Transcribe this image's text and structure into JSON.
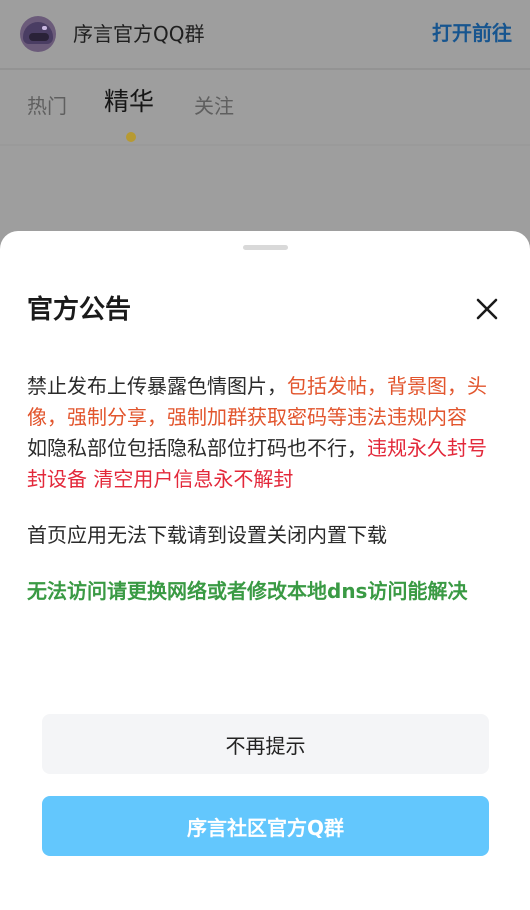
{
  "header": {
    "group_name": "序言官方QQ群",
    "open_label": "打开前往"
  },
  "tabs": [
    {
      "label": "热门"
    },
    {
      "label": "精华",
      "active": true
    },
    {
      "label": "关注"
    }
  ],
  "dialog": {
    "title": "官方公告",
    "lines": {
      "p1_normal": "禁止发布上传暴露色情图片，",
      "p1_orange": "包括发帖，背景图，头像，强制分享，强制加群获取密码等违法违规内容",
      "p2_normal": "如隐私部位包括隐私部位打码也不行，",
      "p2_red": "违规永久封号封设备 清空用户信息永不解封",
      "p3": "首页应用无法下载请到设置关闭内置下载",
      "p4": "无法访问请更换网络或者修改本地dns访问能解决"
    },
    "dismiss_label": "不再提示",
    "group_button_label": "序言社区官方Q群"
  },
  "colors": {
    "accent_blue": "#17558f",
    "warning_orange": "#e2552d",
    "danger_red": "#e3283a",
    "success_green": "#3a9a44",
    "primary_button": "#63c7fd"
  }
}
